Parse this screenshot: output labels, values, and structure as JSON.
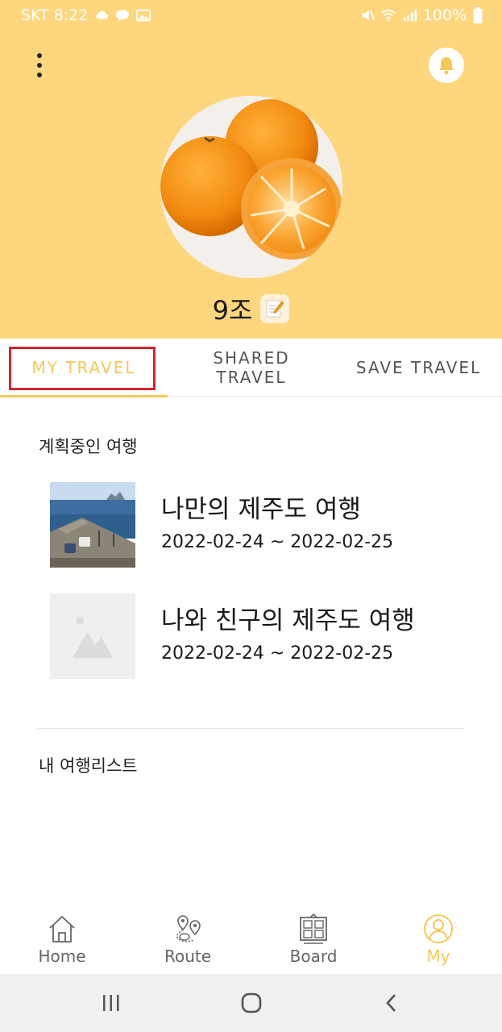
{
  "status_bar": {
    "carrier_time": "SKT 8:22",
    "battery": "100%",
    "icons": [
      "cloud-icon",
      "chat-icon",
      "image-icon",
      "mute-icon",
      "wifi-icon",
      "signal-icon",
      "battery-icon"
    ]
  },
  "header": {
    "menu_icon": "more-vertical-icon",
    "bell_icon": "bell-icon",
    "background_color": "#FED67E"
  },
  "profile": {
    "name": "9조",
    "avatar": "tangerines-photo",
    "edit_icon": "memo-pencil-icon"
  },
  "tabs": [
    {
      "label": "MY TRAVEL",
      "active": true
    },
    {
      "label": "SHARED\nTRAVEL",
      "active": false
    },
    {
      "label": "SAVE TRAVEL",
      "active": false
    }
  ],
  "accent_color": "#F4C85B",
  "highlight_color": "#D4262E",
  "sections": {
    "planning_title": "계획중인 여행",
    "my_list_title": "내 여행리스트"
  },
  "trips": [
    {
      "title": "나만의 제주도 여행",
      "dates": "2022-02-24 ~ 2022-02-25",
      "thumbnail": "harbor-photo"
    },
    {
      "title": "나와 친구의 제주도 여행",
      "dates": "2022-02-24 ~ 2022-02-25",
      "thumbnail": "image-placeholder-icon"
    }
  ],
  "bottom_nav": [
    {
      "label": "Home",
      "icon": "home-icon",
      "active": false
    },
    {
      "label": "Route",
      "icon": "route-pin-icon",
      "active": false
    },
    {
      "label": "Board",
      "icon": "board-icon",
      "active": false
    },
    {
      "label": "My",
      "icon": "user-circle-icon",
      "active": true
    }
  ],
  "system_nav": [
    "recent-apps-icon",
    "home-circle-icon",
    "back-icon"
  ]
}
